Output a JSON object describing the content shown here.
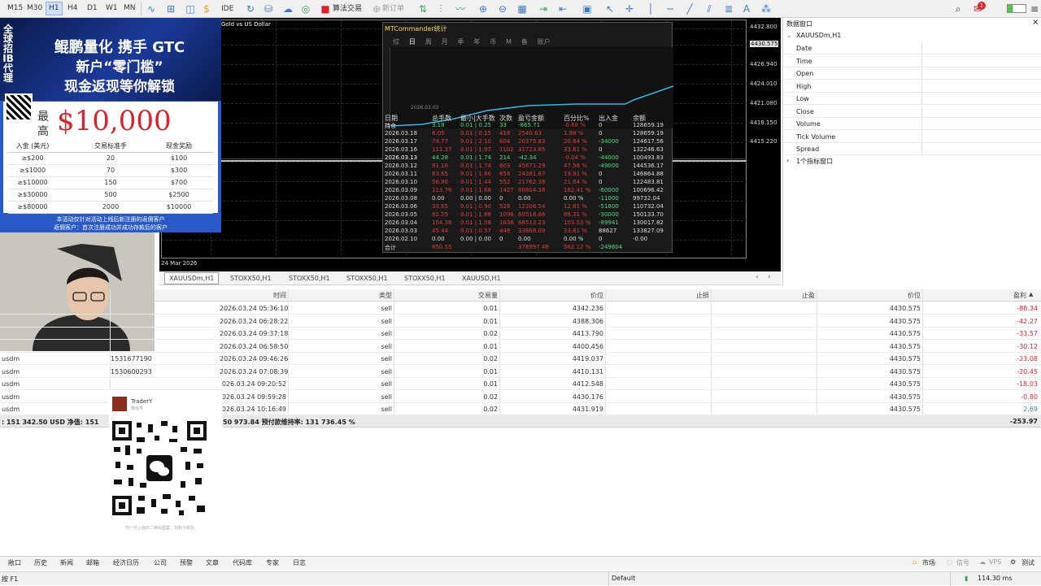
{
  "toolbar": {
    "timeframes": [
      "M15",
      "M30",
      "H1",
      "H4",
      "D1",
      "W1",
      "MN"
    ],
    "active_timeframe": "H1",
    "ide_label": "IDE",
    "algo_trading_label": "算法交易",
    "new_order_label": "新订单",
    "alert_badge": "1"
  },
  "chart": {
    "title": "Gold vs US Dollar",
    "date_label": "24 Mar 2026",
    "price_labels": [
      "4432.800",
      "4430.575",
      "4426.940",
      "4424.010",
      "4421.080",
      "4418.150",
      "4415.220"
    ]
  },
  "stats": {
    "title": "MTCommander统计",
    "tabs": [
      "综",
      "日",
      "周",
      "月",
      "季",
      "年",
      "币",
      "M",
      "备",
      "账户"
    ],
    "active_tab": "日",
    "equity_axis_label": "2026.03.03",
    "headers": [
      "日期",
      "总手数",
      "最小|大手数",
      "次数",
      "盈亏金额",
      "百分比%",
      "出入金",
      "余额"
    ],
    "rows": [
      {
        "d": "持仓",
        "lots": "3.18",
        "mm": "0.01 | 0.25",
        "n": "33",
        "pl": "-865.71",
        "pct": "-0.68 %",
        "io": "0",
        "bal": "128659.19",
        "c": "pos"
      },
      {
        "d": "2026.03.18",
        "lots": "6.05",
        "mm": "0.01 | 0.15",
        "n": "418",
        "pl": "2540.63",
        "pct": "1.98 %",
        "io": "0",
        "bal": "128659.19",
        "c": "neg"
      },
      {
        "d": "2026.03.17",
        "lots": "74.77",
        "mm": "0.01 | 2.10",
        "n": "604",
        "pl": "20375.83",
        "pct": "20.84 %",
        "io": "-34000",
        "bal": "124617.56",
        "c": "neg"
      },
      {
        "d": "2026.03.16",
        "lots": "111.37",
        "mm": "0.01 | 1.97",
        "n": "1102",
        "pl": "31723.85",
        "pct": "33.81 %",
        "io": "0",
        "bal": "132246.63",
        "c": "neg"
      },
      {
        "d": "2026.03.13",
        "lots": "44.28",
        "mm": "0.01 | 1.74",
        "n": "214",
        "pl": "-42.34",
        "pct": "-0.04 %",
        "io": "-44000",
        "bal": "100493.83",
        "c": "pos"
      },
      {
        "d": "2026.03.12",
        "lots": "91.18",
        "mm": "0.01 | 1.74",
        "n": "603",
        "pl": "45671.29",
        "pct": "47.58 %",
        "io": "-49000",
        "bal": "144536.17",
        "c": "neg"
      },
      {
        "d": "2026.03.11",
        "lots": "63.65",
        "mm": "0.01 | 1.66",
        "n": "658",
        "pl": "24381.87",
        "pct": "19.91 %",
        "io": "0",
        "bal": "146864.88",
        "c": "neg"
      },
      {
        "d": "2026.03.10",
        "lots": "56.86",
        "mm": "0.01 | 1.44",
        "n": "552",
        "pl": "21762.38",
        "pct": "21.64 %",
        "io": "0",
        "bal": "122483.81",
        "c": "neg"
      },
      {
        "d": "2026.03.09",
        "lots": "113.76",
        "mm": "0.01 | 1.68",
        "n": "1427",
        "pl": "80804.38",
        "pct": "162.41 %",
        "io": "-60000",
        "bal": "100696.42",
        "c": "neg"
      },
      {
        "d": "2026.03.08",
        "lots": "0.00",
        "mm": "0.00 | 0.00",
        "n": "0",
        "pl": "0.00",
        "pct": "0.00 %",
        "io": "-11000",
        "bal": "99732.04",
        "c": "plain"
      },
      {
        "d": "2026.03.06",
        "lots": "33.65",
        "mm": "0.01 | 0.90",
        "n": "528",
        "pl": "12306.54",
        "pct": "12.81 %",
        "io": "-51800",
        "bal": "110732.04",
        "c": "neg"
      },
      {
        "d": "2026.03.05",
        "lots": "92.55",
        "mm": "0.01 | 1.88",
        "n": "1096",
        "pl": "60518.66",
        "pct": "88.31 %",
        "io": "-30000",
        "bal": "150133.70",
        "c": "neg"
      },
      {
        "d": "2026.03.04",
        "lots": "104.38",
        "mm": "0.01 | 1.08",
        "n": "1836",
        "pl": "68513.23",
        "pct": "103.53 %",
        "io": "-89941",
        "bal": "130017.82",
        "c": "neg"
      },
      {
        "d": "2026.03.03",
        "lots": "45.44",
        "mm": "0.01 | 0.57",
        "n": "448",
        "pl": "33868.09",
        "pct": "33.81 %",
        "io": "88627",
        "bal": "133827.09",
        "c": "neg"
      },
      {
        "d": "2026.02.10",
        "lots": "0.00",
        "mm": "0.00 | 0.00",
        "n": "0",
        "pl": "0.00",
        "pct": "0.00 %",
        "io": "0",
        "bal": "-0.00",
        "c": "plain"
      },
      {
        "d": "合计",
        "lots": "850.55",
        "mm": "",
        "n": "",
        "pl": "378997.48",
        "pct": "562.12 %",
        "io": "-249804",
        "bal": "",
        "c": "neg"
      }
    ]
  },
  "promo": {
    "side_text": [
      "全",
      "球",
      "招",
      "IB",
      "代",
      "理"
    ],
    "line1": "鲲鹏量化 携手 GTC",
    "line2": "新户“零门槛”",
    "line3": "现金返现等你解锁",
    "max_label_top": "最",
    "max_label_bottom": "高",
    "amount": "$10,000",
    "table_headers": [
      "入金 (美元)",
      "交易标准手",
      "现金奖励"
    ],
    "tiers": [
      [
        "≥$200",
        "20",
        "$100"
      ],
      [
        "≥$1000",
        "70",
        "$300"
      ],
      [
        "≥$10000",
        "150",
        "$700"
      ],
      [
        "≥$30000",
        "500",
        "$2500"
      ],
      [
        "≥$80000",
        "2000",
        "$10000"
      ]
    ],
    "footer1": "本活动仅针对活动上线后新注册的返佣客户",
    "footer2": "返佣客户：首次注册成功并成功存款后的客户"
  },
  "data_window": {
    "title": "数据窗口",
    "symbol": "XAUUSDm,H1",
    "rows": [
      "Date",
      "Time",
      "Open",
      "High",
      "Low",
      "Close",
      "Volume",
      "Tick Volume",
      "Spread"
    ],
    "indicator_window": "1个指标窗口"
  },
  "chart_tabs": [
    "XAUUSDm,H1",
    "STOXX50,H1",
    "STOXX50,H1",
    "STOXX50,H1",
    "STOXX50,H1",
    "XAUUSD,H1"
  ],
  "active_chart_tab": "XAUUSDm,H1",
  "trade_table": {
    "headers": {
      "time": "时间",
      "type": "类型",
      "volume": "交易量",
      "price": "价位",
      "sl": "止损",
      "tp": "止盈",
      "cur": "价位",
      "profit": "盈利"
    },
    "rows": [
      {
        "sym": "",
        "ticket": "",
        "time": "2026.03.24 05:36:10",
        "type": "sell",
        "vol": "0.01",
        "price": "4342.236",
        "cur": "4430.575",
        "profit": "-88.34",
        "neg": true
      },
      {
        "sym": "",
        "ticket": "",
        "time": "2026.03.24 06:28:22",
        "type": "sell",
        "vol": "0.01",
        "price": "4388.306",
        "cur": "4430.575",
        "profit": "-42.27",
        "neg": true
      },
      {
        "sym": "",
        "ticket": "",
        "time": "2026.03.24 09:37:18",
        "type": "sell",
        "vol": "0.02",
        "price": "4413.790",
        "cur": "4430.575",
        "profit": "-33.57",
        "neg": true
      },
      {
        "sym": "",
        "ticket": "",
        "time": "2026.03.24 06:58:50",
        "type": "sell",
        "vol": "0.01",
        "price": "4400.456",
        "cur": "4430.575",
        "profit": "-30.12",
        "neg": true
      },
      {
        "sym": "usdm",
        "ticket": "1531677190",
        "time": "2026.03.24 09:46:26",
        "type": "sell",
        "vol": "0.02",
        "price": "4419.037",
        "cur": "4430.575",
        "profit": "-23.08",
        "neg": true
      },
      {
        "sym": "usdm",
        "ticket": "1530600293",
        "time": "2026.03.24 07:08:39",
        "type": "sell",
        "vol": "0.01",
        "price": "4410.131",
        "cur": "4430.575",
        "profit": "-20.45",
        "neg": true
      },
      {
        "sym": "usdm",
        "ticket": "",
        "time": "026.03.24 09:20:52",
        "type": "sell",
        "vol": "0.01",
        "price": "4412.548",
        "cur": "4430.575",
        "profit": "-18.03",
        "neg": true
      },
      {
        "sym": "usdm",
        "ticket": "",
        "time": "026.03.24 09:59:28",
        "type": "sell",
        "vol": "0.02",
        "price": "4430.176",
        "cur": "4430.575",
        "profit": "-0.80",
        "neg": true
      },
      {
        "sym": "usdm",
        "ticket": "",
        "time": "026.03.24 10:16:49",
        "type": "sell",
        "vol": "0.02",
        "price": "4431.919",
        "cur": "4430.575",
        "profit": "2.69",
        "neg": false
      }
    ],
    "summary_left": ": 151 342.50 USD  净值: 151",
    "summary_mid": "50 973.84  预付款维持率: 131 736.45 %",
    "summary_total": "-253.97"
  },
  "qr_card": {
    "name": "TraderY",
    "sub": "微信号",
    "caption": "扫一扫上面的二维码图案，加我为朋友。"
  },
  "bottom_tabs": [
    "敞口",
    "历史",
    "新闻",
    "邮箱",
    "经济日历",
    "公司",
    "预警",
    "文章",
    "代码库",
    "专家",
    "日志"
  ],
  "bottom_right": [
    "市场",
    "信号",
    "VPS",
    "测试"
  ],
  "status": {
    "left": "按 F1",
    "profile": "Default",
    "ping": "114.30 ms"
  },
  "colors": {
    "accent": "#3a7bc8",
    "neg": "#d9232d",
    "pos": "#22c55e",
    "chart_bg": "#000000"
  }
}
